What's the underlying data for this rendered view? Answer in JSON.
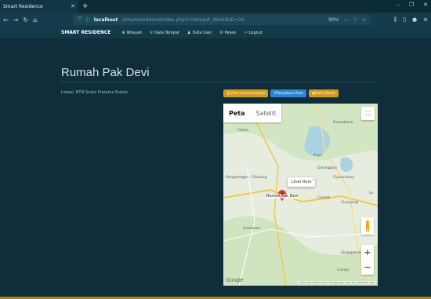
{
  "browser": {
    "tab_title": "Smart Residence",
    "url_host": "localhost",
    "url_path": "/smartresidence/index.php?r=tempat_detail&ID=16",
    "zoom": "90%"
  },
  "navbar": {
    "brand": "SMART RESIDENCE",
    "items": [
      {
        "icon": "map-marker-icon",
        "label": "Wilayah"
      },
      {
        "icon": "location-icon",
        "label": "Data Tempat"
      },
      {
        "icon": "user-icon",
        "label": "Data User"
      },
      {
        "icon": "envelope-icon",
        "label": "Pesan"
      },
      {
        "icon": "logout-icon",
        "label": "Logout"
      }
    ]
  },
  "page": {
    "title": "Rumah Pak Devi",
    "location": "Lokasi: BTN Sruko Pratama Estate"
  },
  "buttons": {
    "back": "Lihat semua tempat",
    "view": "Tampilkan Rute",
    "detail": "Data Detail"
  },
  "map": {
    "tab_map": "Peta",
    "tab_satellite": "Satelit",
    "places": [
      "Purwakarta",
      "Cibatu",
      "Kopo",
      "Darangdan",
      "Cikalong",
      "Cipeundeuy",
      "Cisalak",
      "Pangalengan",
      "Ciranjang",
      "Sukabumi",
      "Singaparna",
      "Cianjur",
      "Le"
    ],
    "marker_label": "Rumah Pak Devi",
    "info_text": "Lihat Rute",
    "google": "Google",
    "attribution": "Data peta ©2022  Syarat Penggunaan  Laporkan kesalahan peta"
  },
  "colors": {
    "bg": "#0f2d3a",
    "navbar": "#123a48",
    "btn_yellow": "#d29b1a",
    "btn_blue": "#2c86d6",
    "marker": "#e53935"
  }
}
